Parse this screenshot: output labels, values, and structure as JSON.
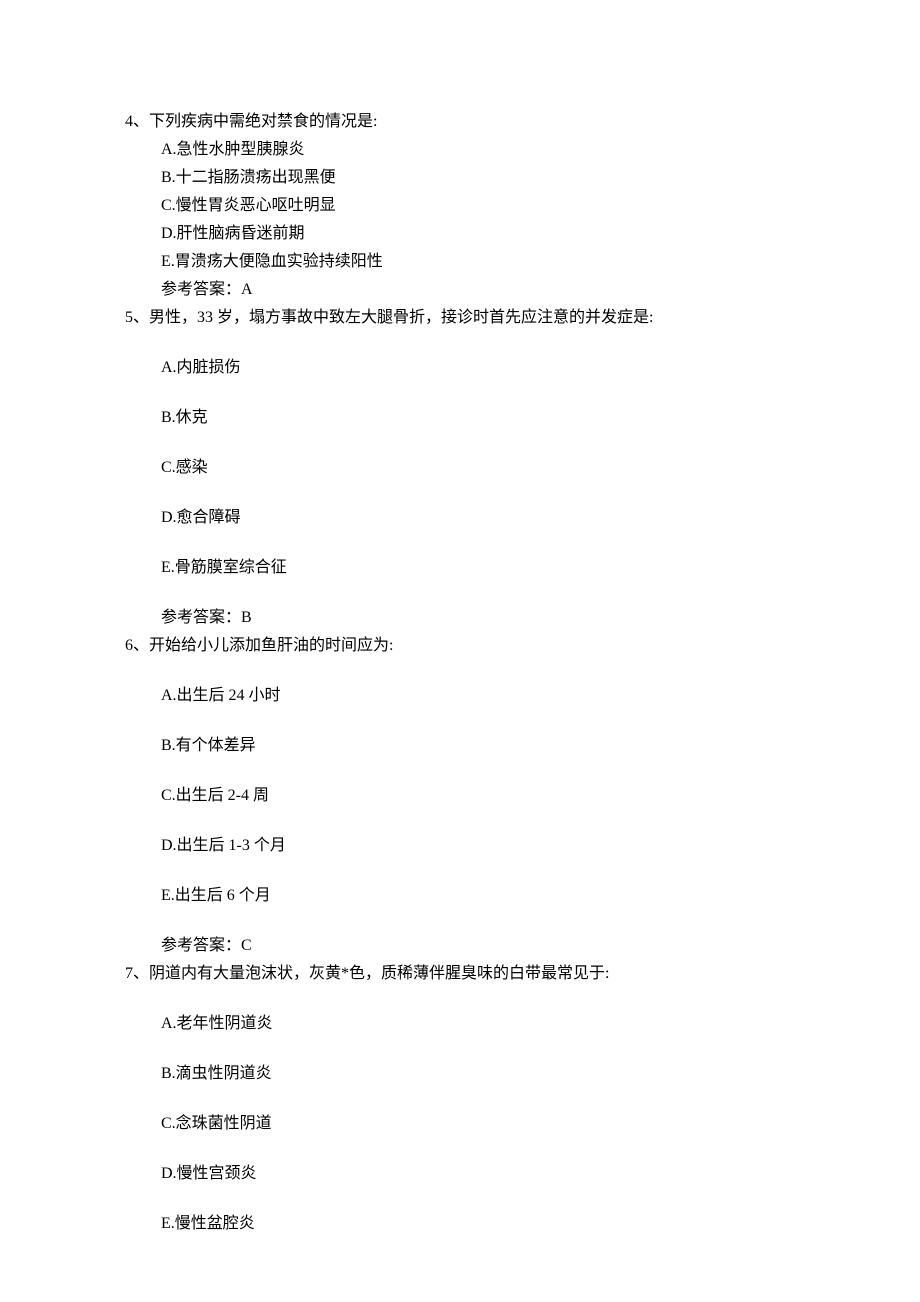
{
  "questions": [
    {
      "number": "4、",
      "stem": "下列疾病中需绝对禁食的情况是:",
      "options": [
        "A.急性水肿型胰腺炎",
        "B.十二指肠溃疡出现黑便",
        "C.慢性胃炎恶心呕吐明显",
        "D.肝性脑病昏迷前期",
        "E.胃溃疡大便隐血实验持续阳性"
      ],
      "answer": "参考答案：A"
    },
    {
      "number": "5、",
      "stem": "男性，33 岁，塌方事故中致左大腿骨折，接诊时首先应注意的并发症是:",
      "options": [
        "A.内脏损伤",
        "B.休克",
        "C.感染",
        "D.愈合障碍",
        "E.骨筋膜室综合征"
      ],
      "answer": "参考答案：B"
    },
    {
      "number": "6、",
      "stem": "开始给小儿添加鱼肝油的时间应为:",
      "options": [
        "A.出生后 24 小时",
        "B.有个体差异",
        "C.出生后 2-4 周",
        "D.出生后 1-3 个月",
        "E.出生后 6 个月"
      ],
      "answer": "参考答案：C"
    },
    {
      "number": "7、",
      "stem": "阴道内有大量泡沫状，灰黄*色，质稀薄伴腥臭味的白带最常见于:",
      "options": [
        "A.老年性阴道炎",
        "B.滴虫性阴道炎",
        "C.念珠菌性阴道",
        "D.慢性宫颈炎",
        "E.慢性盆腔炎"
      ],
      "answer": ""
    }
  ]
}
